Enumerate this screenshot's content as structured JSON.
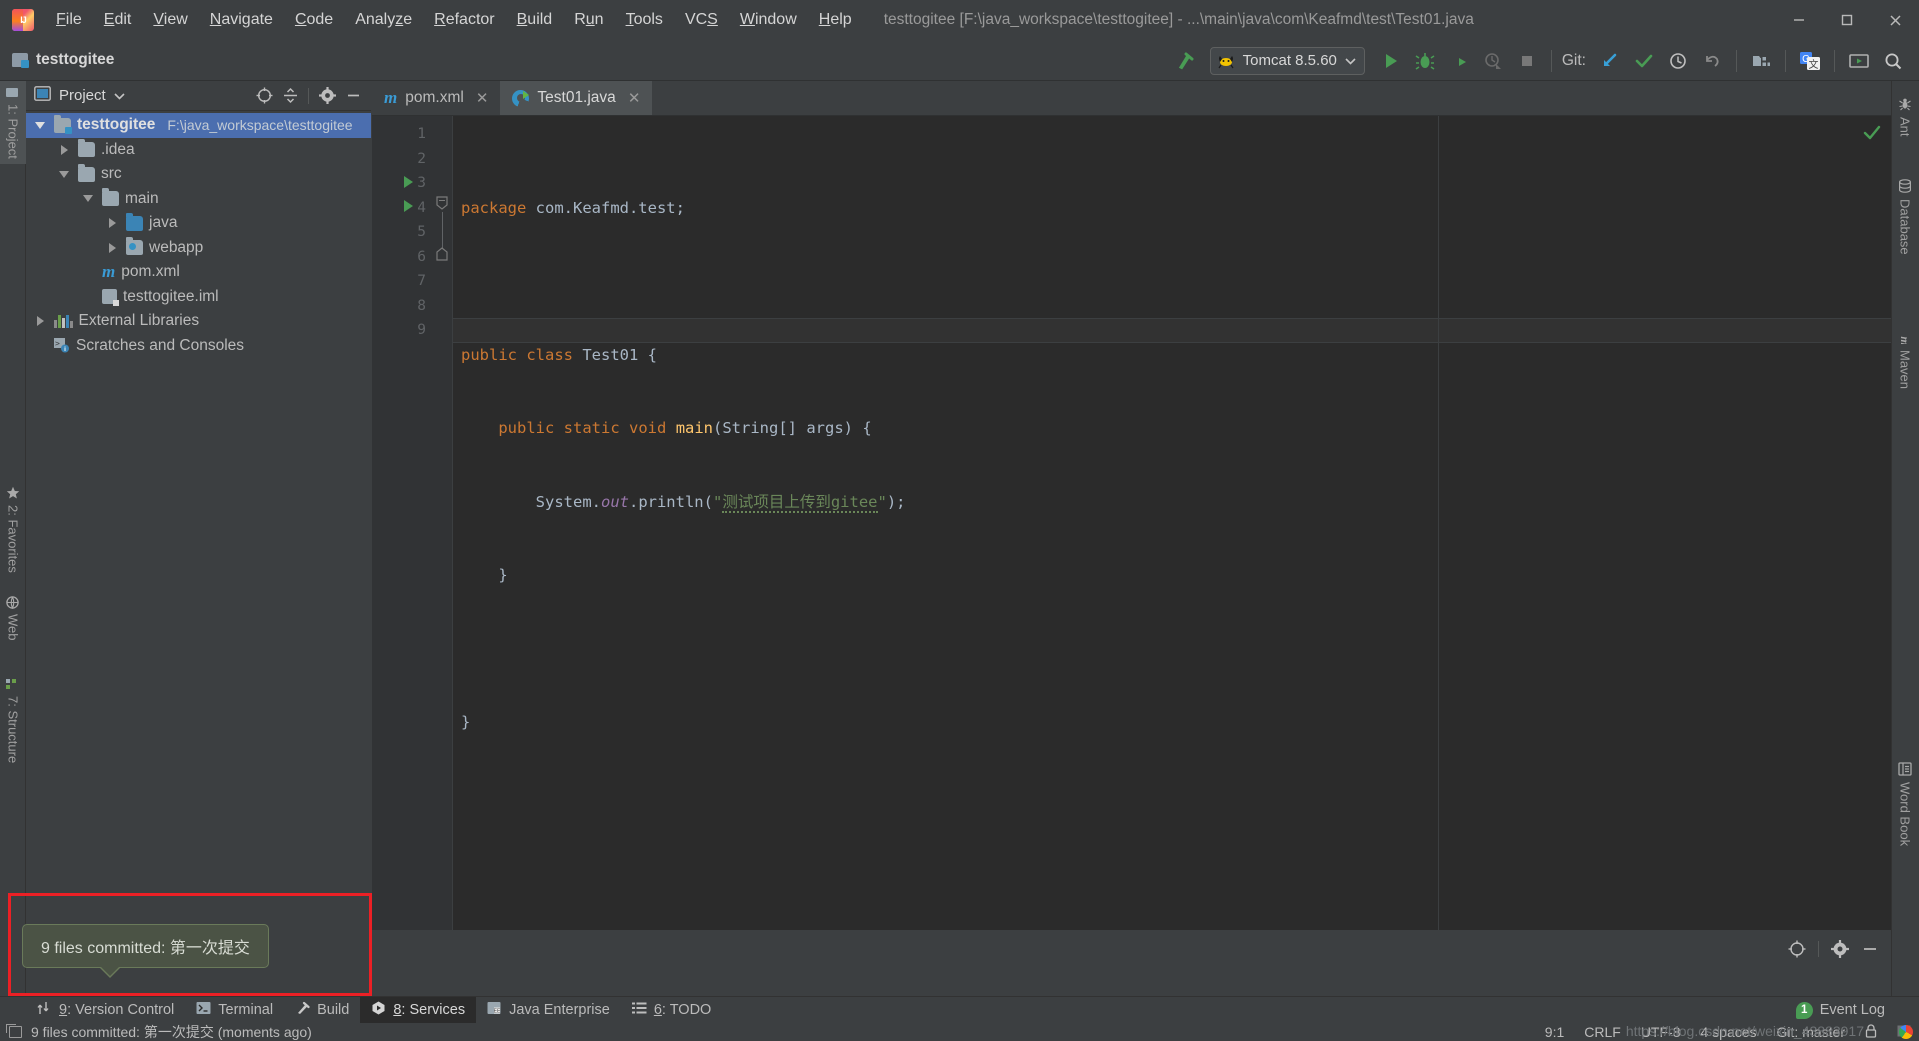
{
  "window": {
    "title": "testtogitee [F:\\java_workspace\\testtogitee] - ...\\main\\java\\com\\Keafmd\\test\\Test01.java",
    "minimize": "—",
    "maximize": "□",
    "close": "✕"
  },
  "menu": [
    {
      "label": "File",
      "mnemonic": "F"
    },
    {
      "label": "Edit",
      "mnemonic": "E"
    },
    {
      "label": "View",
      "mnemonic": "V"
    },
    {
      "label": "Navigate",
      "mnemonic": "N"
    },
    {
      "label": "Code",
      "mnemonic": "C"
    },
    {
      "label": "Analyze",
      "mnemonic": "z"
    },
    {
      "label": "Refactor",
      "mnemonic": "R"
    },
    {
      "label": "Build",
      "mnemonic": "B"
    },
    {
      "label": "Run",
      "mnemonic": "u"
    },
    {
      "label": "Tools",
      "mnemonic": "T"
    },
    {
      "label": "VCS",
      "mnemonic": "S"
    },
    {
      "label": "Window",
      "mnemonic": "W"
    },
    {
      "label": "Help",
      "mnemonic": "H"
    }
  ],
  "toolbar": {
    "project_name": "testtogitee",
    "run_config": "Tomcat 8.5.60",
    "git_label": "Git:",
    "icons": [
      "build-hammer-icon",
      "run-icon",
      "debug-icon",
      "run-with-coverage-icon",
      "profiler-icon",
      "stop-icon",
      "update-project-icon",
      "commit-icon",
      "history-icon",
      "rollback-icon",
      "project-structure-icon",
      "translate-icon",
      "presentation-icon",
      "search-everywhere-icon"
    ]
  },
  "left_strip": [
    {
      "label": "1: Project",
      "mnemonic": "1",
      "active": true
    },
    {
      "label": "2: Favorites",
      "mnemonic": "2",
      "active": false
    },
    {
      "label": "Web",
      "mnemonic": "",
      "active": false
    },
    {
      "label": "7: Structure",
      "mnemonic": "7",
      "active": false
    }
  ],
  "right_strip": [
    {
      "label": "Ant",
      "icon": "ant-icon"
    },
    {
      "label": "Database",
      "icon": "database-icon"
    },
    {
      "label": "Maven",
      "icon": "maven-icon"
    },
    {
      "label": "Word Book",
      "icon": "word-book-icon"
    }
  ],
  "project_panel": {
    "title": "Project",
    "actions": [
      "select-opened-file-icon",
      "collapse-all-icon",
      "settings-gear-icon",
      "hide-icon"
    ],
    "tree": [
      {
        "name": "testtogitee",
        "path": "F:\\java_workspace\\testtogitee",
        "indent": 0,
        "arrow": "down",
        "icon": "module-folder",
        "selected": true,
        "bold": true
      },
      {
        "name": ".idea",
        "path": "",
        "indent": 1,
        "arrow": "right",
        "icon": "folder",
        "selected": false,
        "bold": false
      },
      {
        "name": "src",
        "path": "",
        "indent": 1,
        "arrow": "down",
        "icon": "folder",
        "selected": false,
        "bold": false
      },
      {
        "name": "main",
        "path": "",
        "indent": 2,
        "arrow": "down",
        "icon": "folder",
        "selected": false,
        "bold": false
      },
      {
        "name": "java",
        "path": "",
        "indent": 3,
        "arrow": "right",
        "icon": "source-folder",
        "selected": false,
        "bold": false
      },
      {
        "name": "webapp",
        "path": "",
        "indent": 3,
        "arrow": "right",
        "icon": "web-folder",
        "selected": false,
        "bold": false
      },
      {
        "name": "pom.xml",
        "path": "",
        "indent": 2,
        "arrow": "none",
        "icon": "maven-file",
        "selected": false,
        "bold": false
      },
      {
        "name": "testtogitee.iml",
        "path": "",
        "indent": 2,
        "arrow": "none",
        "icon": "iml-file",
        "selected": false,
        "bold": false
      },
      {
        "name": "External Libraries",
        "path": "",
        "indent": 0,
        "arrow": "right",
        "icon": "libraries",
        "selected": false,
        "bold": false
      },
      {
        "name": "Scratches and Consoles",
        "path": "",
        "indent": 0,
        "arrow": "none",
        "icon": "scratches",
        "selected": false,
        "bold": false
      }
    ]
  },
  "editor": {
    "tabs": [
      {
        "label": "pom.xml",
        "icon": "maven-file-icon",
        "active": false
      },
      {
        "label": "Test01.java",
        "icon": "java-class-icon",
        "active": true
      }
    ],
    "line_numbers": [
      "1",
      "2",
      "3",
      "4",
      "5",
      "6",
      "7",
      "8",
      "9"
    ],
    "code_lines": [
      "package com.Keafmd.test;",
      "",
      "public class Test01 {",
      "    public static void main(String[] args) {",
      "        System.out.println(\"测试项目上传到gitee\");",
      "    }",
      "",
      "}",
      ""
    ],
    "string_literal": "测试项目上传到gitee",
    "caret_line": 9
  },
  "notification": {
    "balloon_text": "9 files committed: 第一次提交",
    "status_text": "9 files committed: 第一次提交 (moments ago)"
  },
  "bottom_tabs": [
    {
      "label": "9: Version Control",
      "mnemonic": "9",
      "icon": "version-control-icon",
      "active": false
    },
    {
      "label": "Terminal",
      "mnemonic": "",
      "icon": "terminal-icon",
      "active": false
    },
    {
      "label": "Build",
      "mnemonic": "",
      "icon": "build-hammer-icon",
      "active": false
    },
    {
      "label": "8: Services",
      "mnemonic": "8",
      "icon": "services-icon",
      "active": true
    },
    {
      "label": "Java Enterprise",
      "mnemonic": "",
      "icon": "java-enterprise-icon",
      "active": false
    },
    {
      "label": "6: TODO",
      "mnemonic": "6",
      "icon": "todo-list-icon",
      "active": false
    }
  ],
  "event_log": {
    "label": "Event Log",
    "count": "1"
  },
  "status_right": [
    {
      "label": "9:1",
      "name": "caret-position"
    },
    {
      "label": "CRLF",
      "name": "line-separator"
    },
    {
      "label": "UTF-8",
      "name": "file-encoding"
    },
    {
      "label": "4 spaces",
      "name": "indent-setting"
    },
    {
      "label": "Git: master",
      "name": "git-branch"
    }
  ],
  "watermark": "https://blog.csdn.net/weixin_43883917",
  "colors": {
    "accent_blue": "#4b6eaf",
    "green_run": "#499c54",
    "panel_bg": "#3c3f41",
    "editor_bg": "#2b2b2b",
    "gutter_bg": "#313335",
    "annotation_red": "#ec2025",
    "balloon_bg": "#4b5345"
  }
}
